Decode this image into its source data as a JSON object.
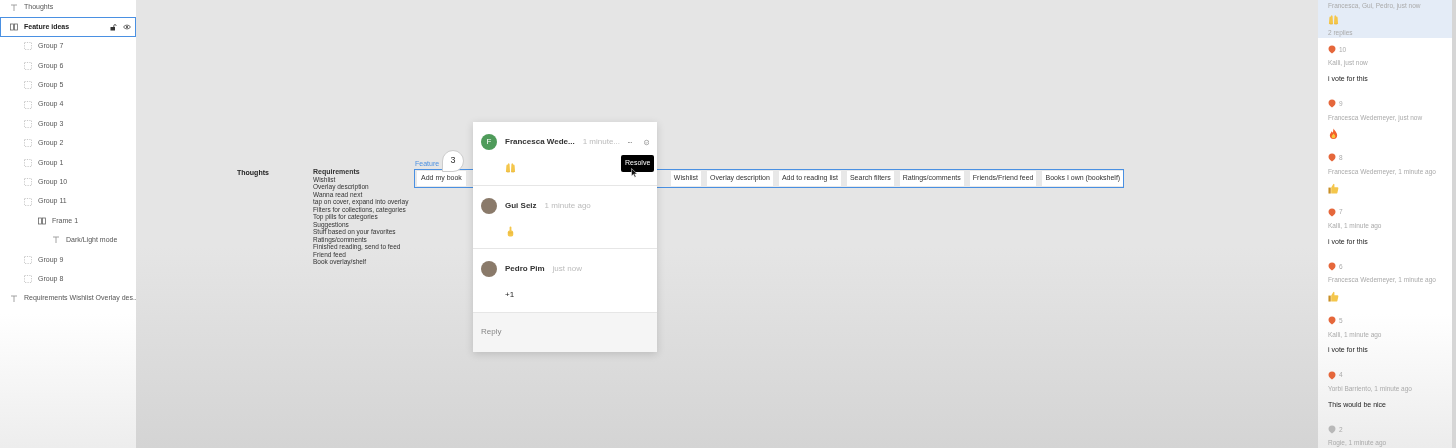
{
  "layers": [
    {
      "kind": "text",
      "name": "Thoughts",
      "selected": false
    },
    {
      "kind": "frame",
      "name": "Feature ideas",
      "selected": true,
      "children": [
        {
          "kind": "group",
          "name": "Group 7",
          "selected": false
        },
        {
          "kind": "group",
          "name": "Group 6",
          "selected": false
        },
        {
          "kind": "group",
          "name": "Group 5",
          "selected": false
        },
        {
          "kind": "group",
          "name": "Group 4",
          "selected": false
        },
        {
          "kind": "group",
          "name": "Group 3",
          "selected": false
        },
        {
          "kind": "group",
          "name": "Group 2",
          "selected": false
        },
        {
          "kind": "group",
          "name": "Group 1",
          "selected": false
        },
        {
          "kind": "group",
          "name": "Group 10",
          "selected": false
        },
        {
          "kind": "group",
          "name": "Group 11",
          "selected": false,
          "children": [
            {
              "kind": "frame",
              "name": "Frame 1",
              "selected": false,
              "children": [
                {
                  "kind": "text",
                  "name": "Dark/Light mode",
                  "selected": false
                }
              ]
            }
          ]
        },
        {
          "kind": "group",
          "name": "Group 9",
          "selected": false
        },
        {
          "kind": "group",
          "name": "Group 8",
          "selected": false
        }
      ]
    },
    {
      "kind": "text",
      "name": "Requirements Wishlist Overlay des...",
      "selected": false
    }
  ],
  "canvas": {
    "thoughts_label": "Thoughts",
    "requirements": {
      "title": "Requirements",
      "lines": [
        "Wishlist",
        "Overlay description",
        "Wanna read next",
        "tap on cover, expand into overlay",
        "Filters for collections, categories",
        "Top pills for categories",
        "Suggestions",
        "Stuff based on your favorites",
        "Ratings/comments",
        "Finished reading, send to feed",
        "Friend feed",
        "Book overlay/shelf"
      ]
    },
    "frame": {
      "label": "Feature",
      "first_button": "Add my book",
      "buttons": [
        "Wishlist",
        "Overlay description",
        "Add to reading list",
        "Search filters",
        "Ratings/comments",
        "Friends/Friend feed",
        "Books I own (bookshelf)"
      ]
    },
    "pin": {
      "number": "3"
    },
    "thread": {
      "comments": [
        {
          "author": "Francesca Wede...",
          "time": "1 minute...",
          "initial": "F",
          "body": {
            "kind": "raisedhands"
          }
        },
        {
          "author": "Gui Seiz",
          "time": "1 minute ago",
          "body": {
            "kind": "pointup"
          }
        },
        {
          "author": "Pedro Pim",
          "time": "just now",
          "body": {
            "kind": "text",
            "text": "+1"
          }
        }
      ],
      "tooltip": "Resolve",
      "reply_placeholder": "Reply"
    }
  },
  "panel": {
    "selected_thread": {
      "meta": "Francesca, Gui, Pedro, just now",
      "body": {
        "kind": "raisedhands"
      },
      "replies": "2 replies"
    },
    "threads": [
      {
        "number": "10",
        "color": "#e5673b",
        "meta": "Kalli, just now",
        "body": {
          "kind": "text",
          "text": "i vote for this"
        }
      },
      {
        "number": "9",
        "color": "#e5673b",
        "meta": "Francesca Wedemeyer, just now",
        "body": {
          "kind": "fire"
        }
      },
      {
        "number": "8",
        "color": "#e5673b",
        "meta": "Francesca Wedemeyer, 1 minute ago",
        "body": {
          "kind": "thumbsup"
        }
      },
      {
        "number": "7",
        "color": "#e5673b",
        "meta": "Kalli, 1 minute ago",
        "body": {
          "kind": "text",
          "text": "i vote for this"
        }
      },
      {
        "number": "6",
        "color": "#e5673b",
        "meta": "Francesca Wedemeyer, 1 minute ago",
        "body": {
          "kind": "thumbsup"
        }
      },
      {
        "number": "5",
        "color": "#e5673b",
        "meta": "Kalli, 1 minute ago",
        "body": {
          "kind": "text",
          "text": "i vote for this"
        }
      },
      {
        "number": "4",
        "color": "#e5673b",
        "meta": "Yorbi Barriento, 1 minute ago",
        "body": {
          "kind": "text",
          "text": "This would be nice"
        }
      },
      {
        "number": "2",
        "color": "#b8b8b8",
        "meta": "Rogie, 1 minute ago"
      }
    ]
  }
}
